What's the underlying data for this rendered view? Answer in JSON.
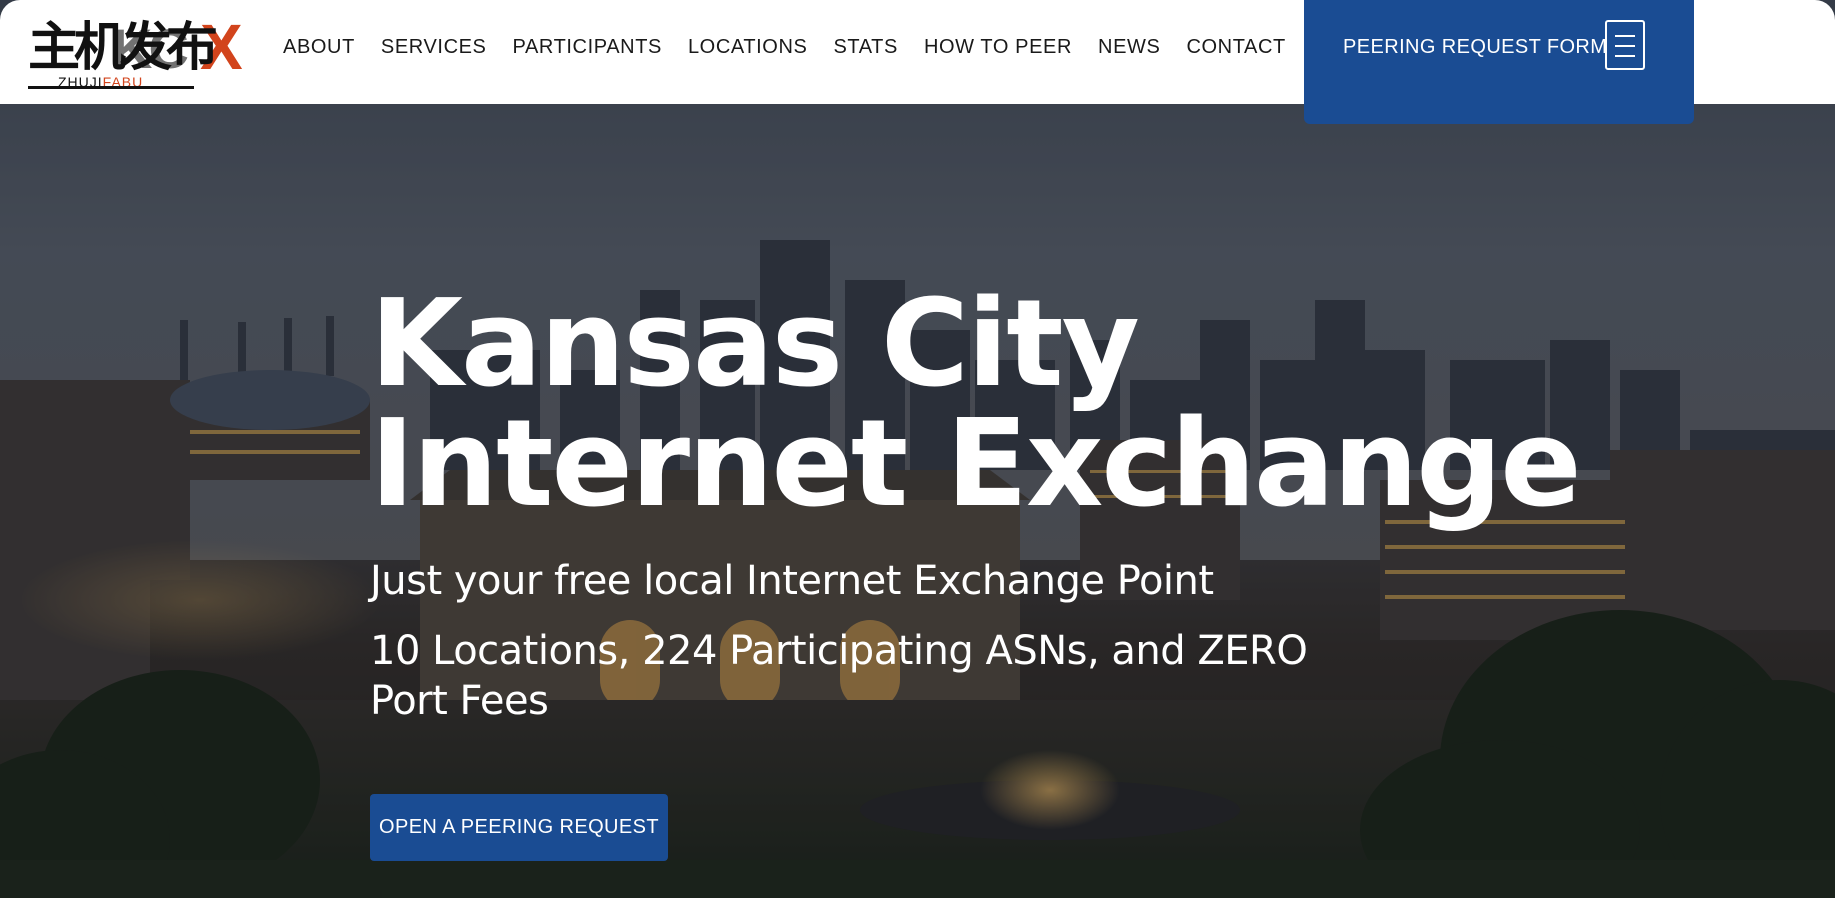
{
  "header": {
    "logo": {
      "chinese_text": "主机发布",
      "brand_letters": "KC",
      "brand_x": "X",
      "sub_left": "ZHUJI",
      "sub_right": "FABU"
    },
    "nav": [
      "ABOUT",
      "SERVICES",
      "PARTICIPANTS",
      "LOCATIONS",
      "STATS",
      "HOW TO PEER",
      "NEWS",
      "CONTACT"
    ],
    "peering_form_label": "PEERING REQUEST FORM"
  },
  "hero": {
    "title_line1": "Kansas City",
    "title_line2": "Internet Exchange",
    "tagline": "Just your free local Internet Exchange Point",
    "stats": "10 Locations, 224 Participating ASNs, and ZERO Port Fees",
    "cta_label": "OPEN A PEERING REQUEST"
  },
  "colors": {
    "brand_blue": "#1a4c93",
    "logo_accent": "#d2441c",
    "header_bg": "#ffffff",
    "hero_text": "#ffffff"
  },
  "icons": {
    "menu": "hamburger-menu-icon"
  }
}
